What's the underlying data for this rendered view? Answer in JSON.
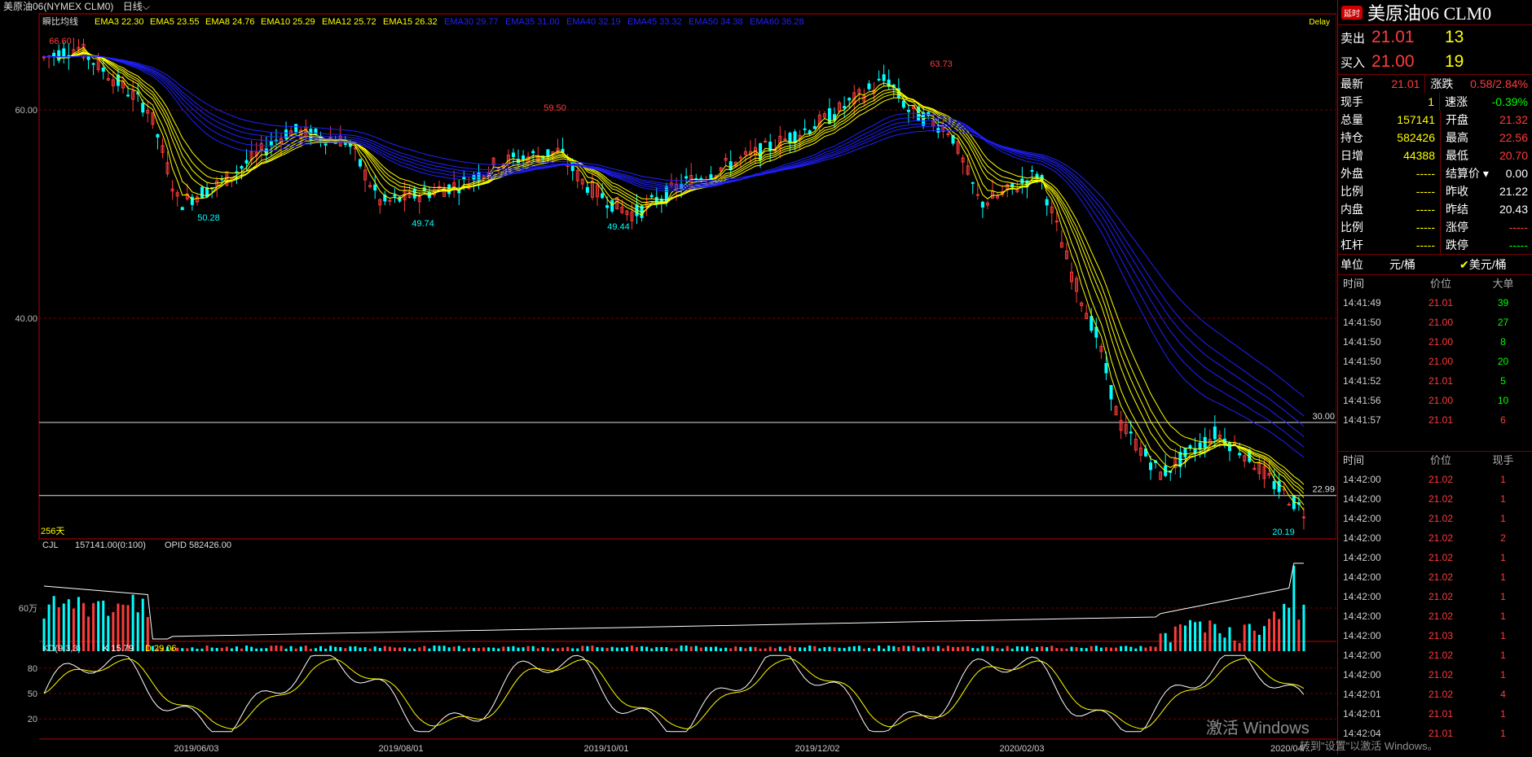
{
  "topbar": {
    "symbol": "美原油06(NYMEX CLM0)",
    "period": "日线"
  },
  "main_chart": {
    "indicator_name": "瞬比均线",
    "ema_fast": [
      {
        "name": "EMA3",
        "value": "22.30"
      },
      {
        "name": "EMA5",
        "value": "23.55"
      },
      {
        "name": "EMA8",
        "value": "24.76"
      },
      {
        "name": "EMA10",
        "value": "25.29"
      },
      {
        "name": "EMA12",
        "value": "25.72"
      },
      {
        "name": "EMA15",
        "value": "26.32"
      }
    ],
    "ema_slow": [
      {
        "name": "EMA30",
        "value": "29.77"
      },
      {
        "name": "EMA35",
        "value": "31.00"
      },
      {
        "name": "EMA40",
        "value": "32.19"
      },
      {
        "name": "EMA45",
        "value": "33.32"
      },
      {
        "name": "EMA50",
        "value": "34.38"
      },
      {
        "name": "EMA60",
        "value": "36.28"
      }
    ],
    "delay_label": "Delay",
    "price_ticks": [
      "60.00",
      "40.00"
    ],
    "peak_labels": [
      "66.60",
      "59.50",
      "63.73"
    ],
    "trough_labels": [
      "50.28",
      "49.74",
      "49.44",
      "20.19"
    ],
    "hline_labels": [
      "30.00",
      "22.99"
    ],
    "days_label": "256天",
    "colors": {
      "up": "#ff3b3b",
      "down": "#00ffff",
      "ema_fast": "#ffff00",
      "ema_slow": "#2020ff",
      "frame": "#c00000"
    }
  },
  "volume_panel": {
    "indicator": "CJL",
    "readout": "157141.00(0:100)",
    "opid": "OPID 582426.00",
    "tick": "60万"
  },
  "kd_panel": {
    "indicator": "KD(9,3,3)",
    "k": "K 15.79",
    "d": "D 29.06",
    "ticks": [
      "80",
      "50",
      "20"
    ]
  },
  "x_axis": [
    "2019/06/03",
    "2019/08/01",
    "2019/10/01",
    "2019/12/02",
    "2020/02/03",
    "2020/04/..."
  ],
  "quote": {
    "badge": "延时",
    "title": "美原油06 CLM0",
    "sell_label": "卖出",
    "sell_price": "21.01",
    "sell_vol": "13",
    "buy_label": "买入",
    "buy_price": "21.00",
    "buy_vol": "19",
    "rows": [
      {
        "l": "最新",
        "v": "21.01",
        "vc": "red",
        "l2": "涨跌",
        "v2": "0.58/2.84%",
        "v2c": "red"
      },
      {
        "l": "现手",
        "v": "1",
        "vc": "yellow",
        "l2": "速涨",
        "v2": "-0.39%",
        "v2c": "green"
      },
      {
        "l": "总量",
        "v": "157141",
        "vc": "yellow",
        "l2": "开盘",
        "v2": "21.32",
        "v2c": "red"
      },
      {
        "l": "持仓",
        "v": "582426",
        "vc": "yellow",
        "l2": "最高",
        "v2": "22.56",
        "v2c": "red"
      },
      {
        "l": "日增",
        "v": "44388",
        "vc": "yellow",
        "l2": "最低",
        "v2": "20.70",
        "v2c": "red"
      },
      {
        "l": "外盘",
        "v": "-----",
        "vc": "yellow",
        "l2": "结算价 ▾",
        "v2": "0.00",
        "v2c": "white"
      },
      {
        "l": "比例",
        "v": "-----",
        "vc": "yellow",
        "l2": "昨收",
        "v2": "21.22",
        "v2c": "white"
      },
      {
        "l": "内盘",
        "v": "-----",
        "vc": "yellow",
        "l2": "昨结",
        "v2": "20.43",
        "v2c": "white"
      },
      {
        "l": "比例",
        "v": "-----",
        "vc": "yellow",
        "l2": "涨停",
        "v2": "-----",
        "v2c": "red"
      },
      {
        "l": "杠杆",
        "v": "-----",
        "vc": "yellow",
        "l2": "跌停",
        "v2": "-----",
        "v2c": "green"
      }
    ],
    "unit_label": "单位",
    "unit_cny": "元/桶",
    "unit_usd": "美元/桶"
  },
  "big_orders": {
    "headers": [
      "时间",
      "价位",
      "大单"
    ],
    "rows": [
      {
        "t": "14:41:49",
        "p": "21.01",
        "v": "39",
        "vc": "green"
      },
      {
        "t": "14:41:50",
        "p": "21.00",
        "v": "27",
        "vc": "green"
      },
      {
        "t": "14:41:50",
        "p": "21.00",
        "v": "8",
        "vc": "green"
      },
      {
        "t": "14:41:50",
        "p": "21.00",
        "v": "20",
        "vc": "green"
      },
      {
        "t": "14:41:52",
        "p": "21.01",
        "v": "5",
        "vc": "green"
      },
      {
        "t": "14:41:56",
        "p": "21.00",
        "v": "10",
        "vc": "green"
      },
      {
        "t": "14:41:57",
        "p": "21.01",
        "v": "6",
        "vc": "red"
      }
    ]
  },
  "ticks": {
    "headers": [
      "时间",
      "价位",
      "现手"
    ],
    "rows": [
      {
        "t": "14:42:00",
        "p": "21.02",
        "v": "1"
      },
      {
        "t": "14:42:00",
        "p": "21.02",
        "v": "1"
      },
      {
        "t": "14:42:00",
        "p": "21.02",
        "v": "1"
      },
      {
        "t": "14:42:00",
        "p": "21.02",
        "v": "2"
      },
      {
        "t": "14:42:00",
        "p": "21.02",
        "v": "1"
      },
      {
        "t": "14:42:00",
        "p": "21.02",
        "v": "1"
      },
      {
        "t": "14:42:00",
        "p": "21.02",
        "v": "1"
      },
      {
        "t": "14:42:00",
        "p": "21.02",
        "v": "1"
      },
      {
        "t": "14:42:00",
        "p": "21.03",
        "v": "1"
      },
      {
        "t": "14:42:00",
        "p": "21.02",
        "v": "1"
      },
      {
        "t": "14:42:00",
        "p": "21.02",
        "v": "1"
      },
      {
        "t": "14:42:01",
        "p": "21.02",
        "v": "4"
      },
      {
        "t": "14:42:01",
        "p": "21.01",
        "v": "1"
      },
      {
        "t": "14:42:04",
        "p": "21.01",
        "v": "1"
      }
    ]
  },
  "watermark": {
    "line1": "激活 Windows",
    "line2": "转到\"设置\"以激活 Windows。"
  }
}
